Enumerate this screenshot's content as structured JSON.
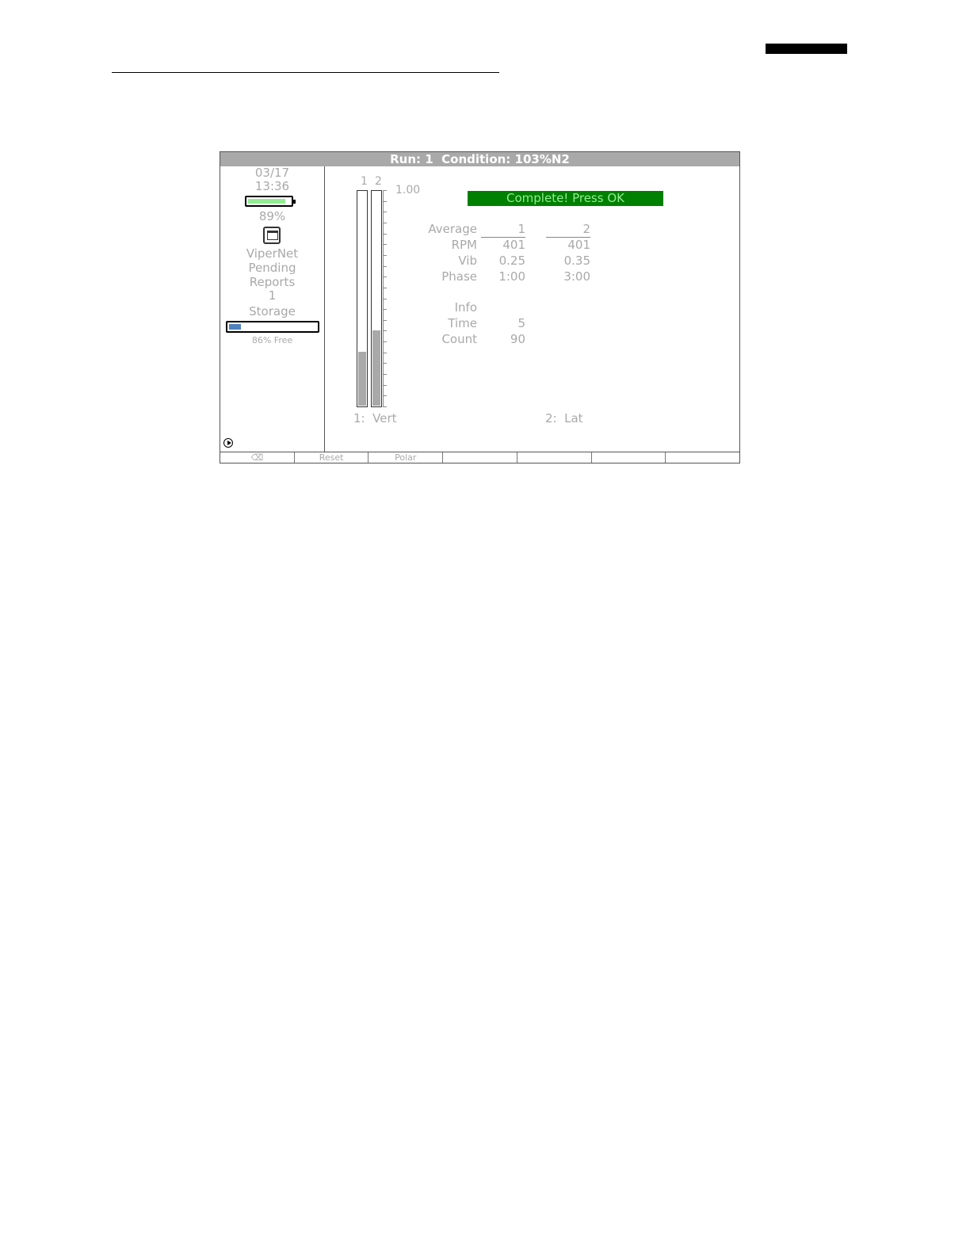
{
  "title_bar": "Run: 1  Condition: 103%N2",
  "status": {
    "date": "03/17",
    "time": "13:36",
    "battery_percent": 89,
    "battery_label": "89%",
    "network_name": "ViperNet",
    "reports_label_1": "Pending",
    "reports_label_2": "Reports",
    "pending_reports": "1",
    "storage_label": "Storage",
    "storage_used_fraction": 0.14,
    "storage_free_label": "86% Free"
  },
  "bars": {
    "labels": [
      "1",
      "2"
    ],
    "levels": [
      0.25,
      0.35
    ],
    "scale_max_label": "1.00"
  },
  "banner": "Complete! Press OK",
  "table": {
    "header": {
      "label": "Average",
      "col1": "1",
      "col2": "2"
    },
    "rows": [
      {
        "label": "RPM",
        "v1": "401",
        "v2": "401"
      },
      {
        "label": "Vib",
        "v1": "0.25",
        "v2": "0.35"
      },
      {
        "label": "Phase",
        "v1": "1:00",
        "v2": "3:00"
      }
    ],
    "info_header": "Info",
    "info_rows": [
      {
        "label": "Time",
        "value": "5"
      },
      {
        "label": "Count",
        "value": "90"
      }
    ]
  },
  "sensors": {
    "sensor1": "1:  Vert",
    "sensor2": "2:  Lat"
  },
  "softkeys": [
    "⌫",
    "Reset",
    "Polar",
    "",
    "",
    "",
    ""
  ],
  "colors": {
    "banner_bg": "#008000",
    "banner_text": "#90ee90",
    "battery_fill": "#90ee90",
    "storage_fill": "#4f81bd",
    "titlebar_bg": "#a9a9a9"
  }
}
